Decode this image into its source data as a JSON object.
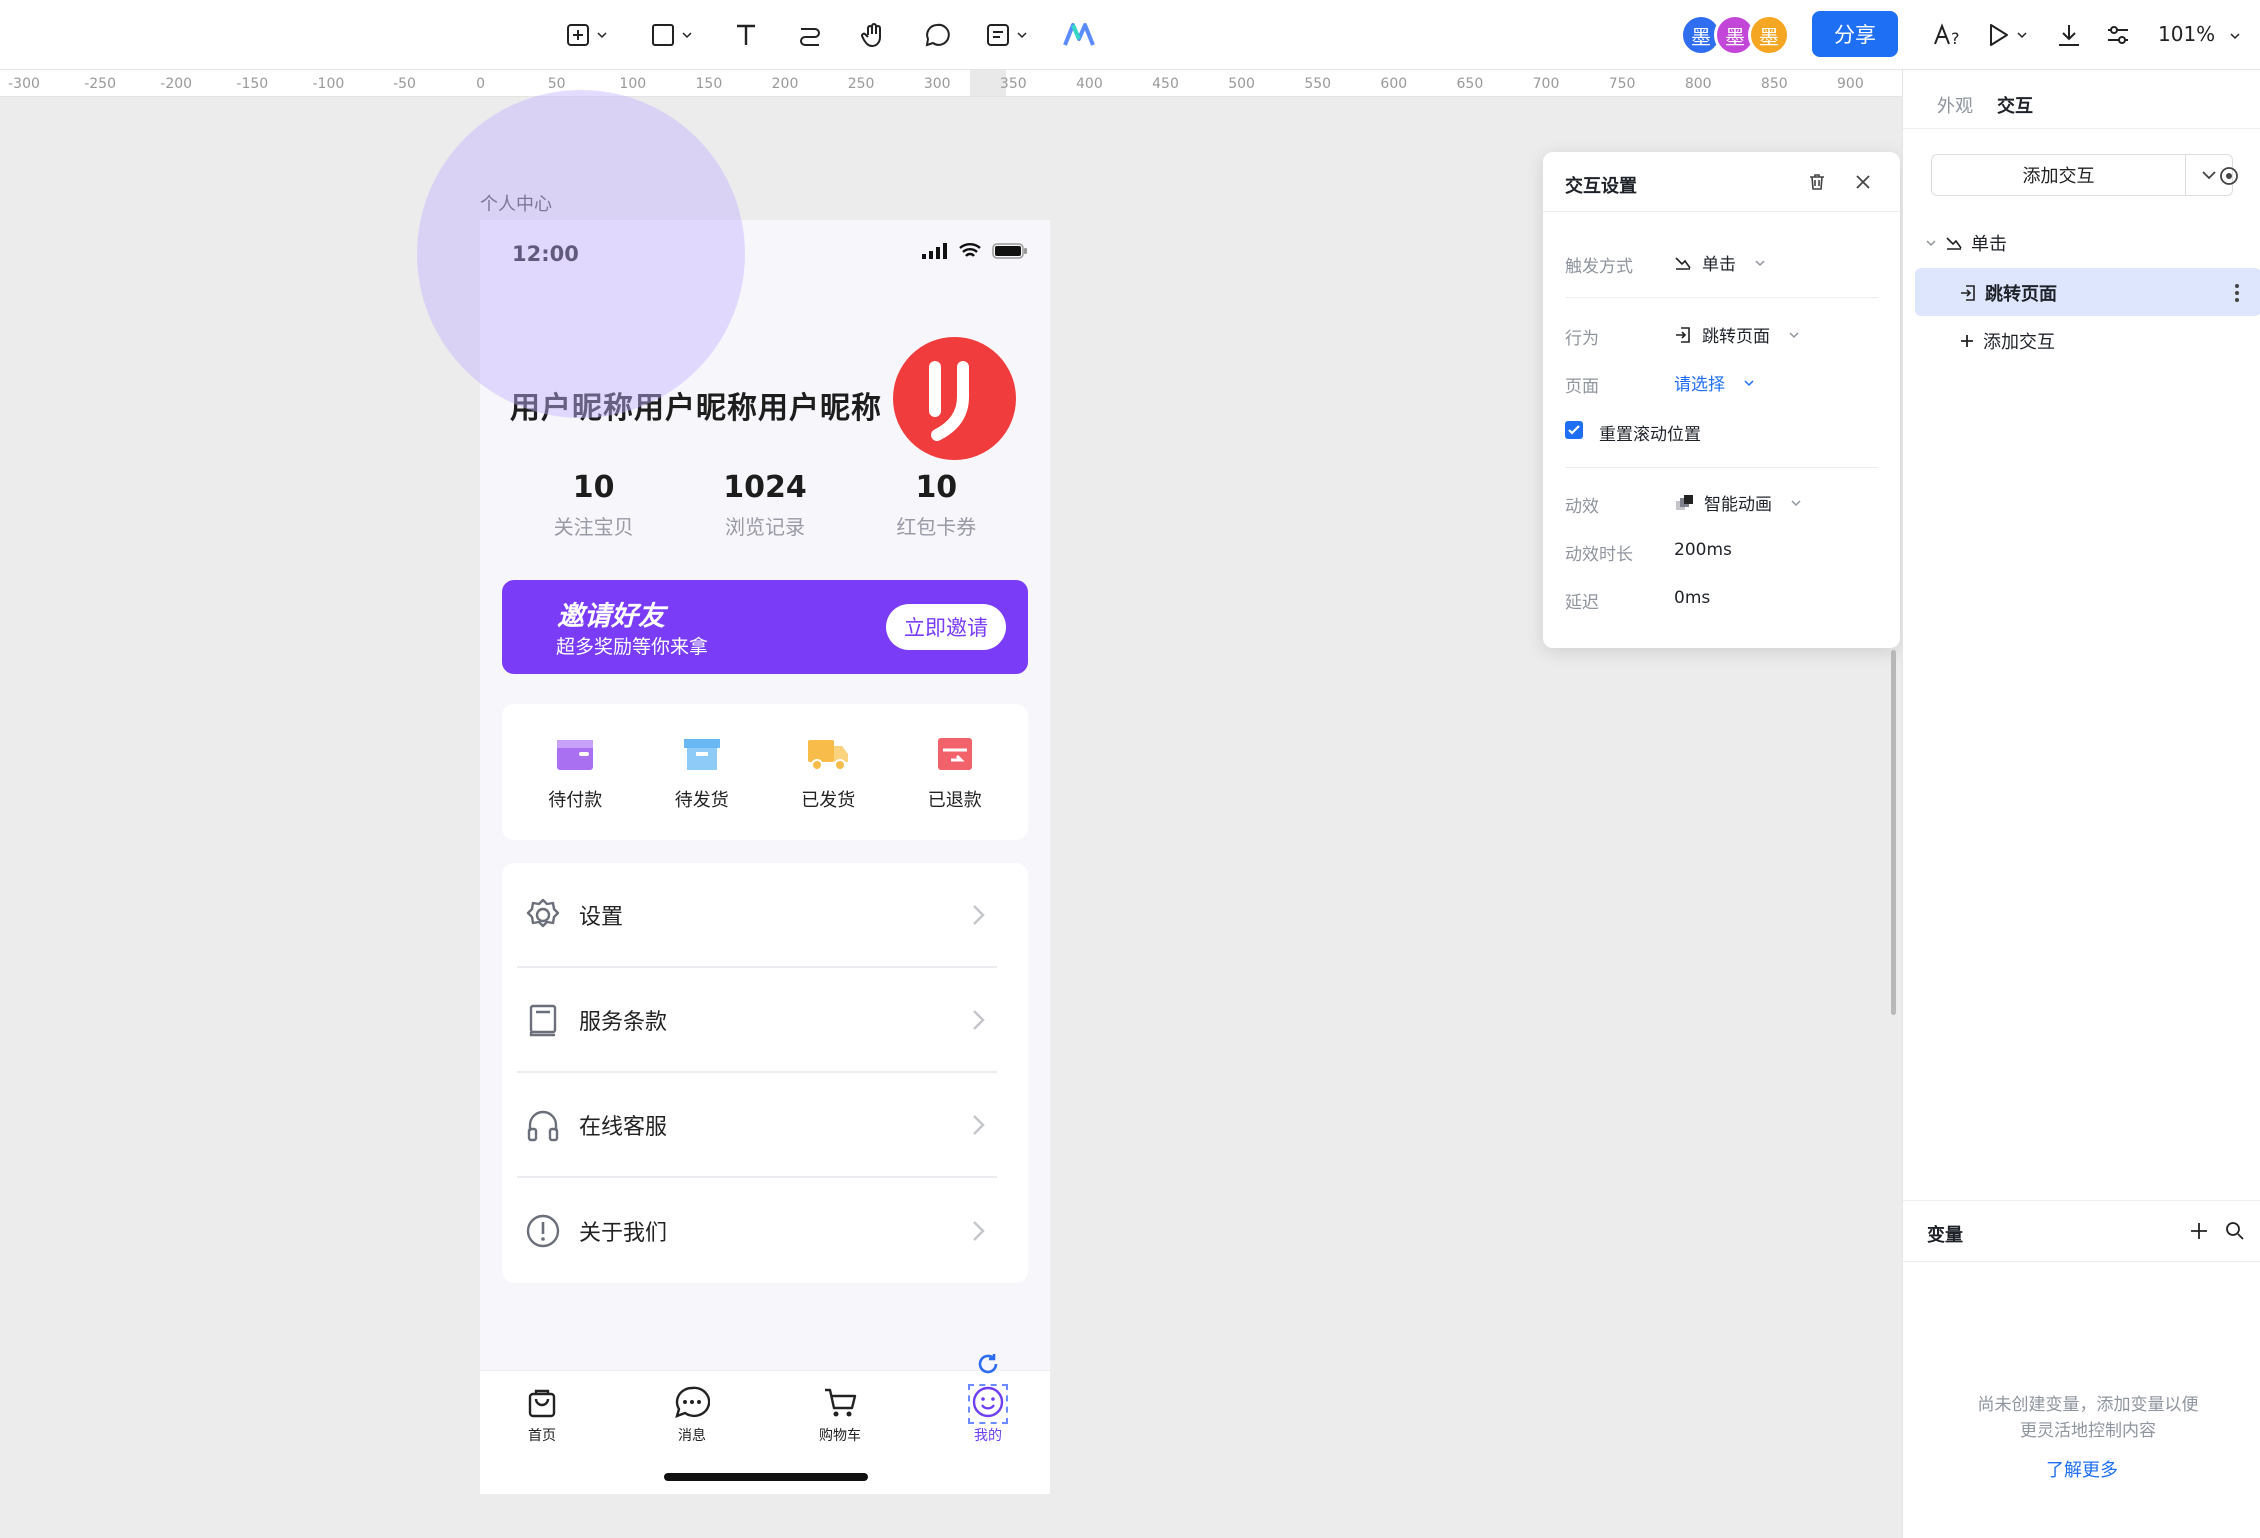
{
  "toolbar": {
    "zoom": "101%",
    "share_label": "分享",
    "avatar_initial": "墨",
    "tools": [
      "frame-tool",
      "shape-tool",
      "text-tool",
      "connector-tool",
      "hand-tool",
      "comment-tool",
      "note-tool",
      "ai-tool"
    ],
    "right_tools": [
      "font-check-icon",
      "play-icon",
      "download-icon",
      "settings-sliders-icon"
    ]
  },
  "ruler": {
    "labels": [
      "-300",
      "-250",
      "-200",
      "-150",
      "-100",
      "-50",
      "0",
      "50",
      "100",
      "150",
      "200",
      "250",
      "300",
      "350",
      "400",
      "450",
      "500",
      "550",
      "600",
      "650",
      "700",
      "750",
      "800",
      "850",
      "900"
    ]
  },
  "canvas": {
    "frame_label": "个人中心"
  },
  "phone": {
    "time": "12:00",
    "nickname": "用户昵称用户昵称用户昵称",
    "stats": [
      {
        "num": "10",
        "label": "关注宝贝"
      },
      {
        "num": "1024",
        "label": "浏览记录"
      },
      {
        "num": "10",
        "label": "红包卡券"
      }
    ],
    "invite": {
      "title": "邀请好友",
      "subtitle": "超多奖励等你来拿",
      "button": "立即邀请"
    },
    "orders": [
      {
        "label": "待付款",
        "icon": "wallet-icon",
        "color": "#a970f2"
      },
      {
        "label": "待发货",
        "icon": "box-icon",
        "color": "#69b8f4"
      },
      {
        "label": "已发货",
        "icon": "truck-icon",
        "color": "#f8bc4a"
      },
      {
        "label": "已退款",
        "icon": "refund-icon",
        "color": "#f2626a"
      }
    ],
    "menu": [
      {
        "label": "设置",
        "icon": "gear-icon"
      },
      {
        "label": "服务条款",
        "icon": "book-icon"
      },
      {
        "label": "在线客服",
        "icon": "headset-icon"
      },
      {
        "label": "关于我们",
        "icon": "info-icon"
      }
    ],
    "tabs": [
      {
        "label": "首页",
        "icon": "bag-icon"
      },
      {
        "label": "消息",
        "icon": "chat-icon"
      },
      {
        "label": "购物车",
        "icon": "cart-icon"
      },
      {
        "label": "我的",
        "icon": "smile-icon"
      }
    ]
  },
  "interaction_panel": {
    "title": "交互设置",
    "trigger_label": "触发方式",
    "trigger_value": "单击",
    "action_label": "行为",
    "action_value": "跳转页面",
    "page_label": "页面",
    "page_value": "请选择",
    "reset_scroll_label": "重置滚动位置",
    "reset_scroll_checked": true,
    "effect_label": "动效",
    "effect_value": "智能动画",
    "duration_label": "动效时长",
    "duration_value": "200ms",
    "delay_label": "延迟",
    "delay_value": "0ms"
  },
  "sidebar": {
    "tabs": [
      "外观",
      "交互"
    ],
    "active_tab": "交互",
    "add_interaction": "添加交互",
    "tree": {
      "trigger": "单击",
      "action": "跳转页面",
      "add": "添加交互"
    },
    "variables_title": "变量",
    "empty_line1": "尚未创建变量，添加变量以便",
    "empty_line2": "更灵活地控制内容",
    "learn_more": "了解更多"
  },
  "colors": {
    "accent": "#1f6ff5",
    "invite_purple": "#7a3cf6",
    "avatar_red": "#f03c3c",
    "selection_bg": "#dde6fd"
  }
}
